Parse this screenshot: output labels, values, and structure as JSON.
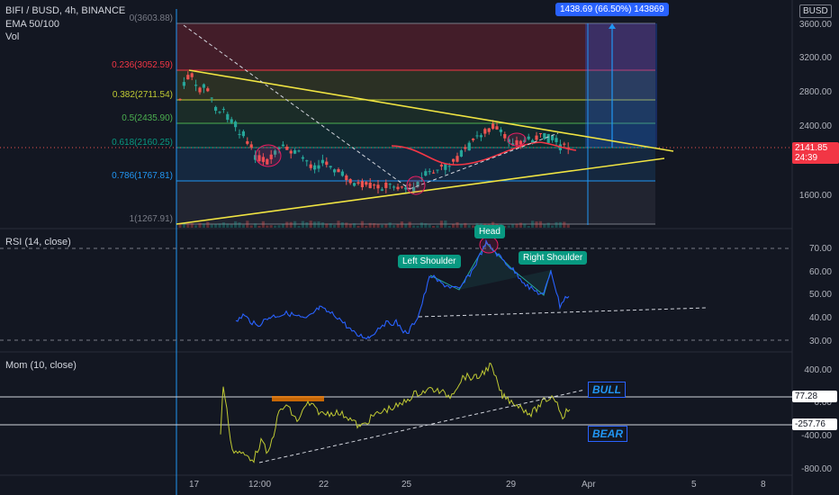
{
  "header": {
    "symbol": "BIFI / BUSD, 4h, BINANCE",
    "ema": "EMA 50/100",
    "vol": "Vol",
    "currency_badge": "BUSD"
  },
  "measure_box": {
    "label": "1438.69 (66.50%) 143869"
  },
  "fib_levels": [
    {
      "label": "0(3603.88)",
      "color": "#787b86"
    },
    {
      "label": "0.236(3052.59)",
      "color": "#f23645"
    },
    {
      "label": "0.382(2711.54)",
      "color": "#c0ca33"
    },
    {
      "label": "0.5(2435.90)",
      "color": "#4caf50"
    },
    {
      "label": "0.618(2160.25)",
      "color": "#089981"
    },
    {
      "label": "0.786(1767.81)",
      "color": "#2196f3"
    },
    {
      "label": "1(1267.91)",
      "color": "#787b86"
    }
  ],
  "price_axis": {
    "labels": [
      "3600.00",
      "3200.00",
      "2800.00",
      "2400.00",
      "1600.00"
    ],
    "current_price": "2141.85",
    "countdown": "24:39"
  },
  "rsi_pane": {
    "title": "RSI (14, close)",
    "axis_labels": [
      "70.00",
      "60.00",
      "50.00",
      "40.00",
      "30.00"
    ],
    "pattern": {
      "left": "Left Shoulder",
      "head": "Head",
      "right": "Right Shoulder"
    }
  },
  "mom_pane": {
    "title": "Mom (10, close)",
    "axis_labels": [
      "400.00",
      "0.00",
      "-400.00",
      "-800.00"
    ],
    "level_high": "77.28",
    "level_low": "-257.76",
    "bull_label": "BULL",
    "bear_label": "BEAR"
  },
  "time_axis": {
    "labels": [
      "17",
      "12:00",
      "22",
      "25",
      "29",
      "Apr",
      "5",
      "8"
    ]
  },
  "colors": {
    "background": "#131722",
    "up": "#26a69a",
    "down": "#ef5350",
    "rsi_line": "#2962ff",
    "mom_line": "#c0ca33",
    "trendline": "#f0e442"
  }
}
